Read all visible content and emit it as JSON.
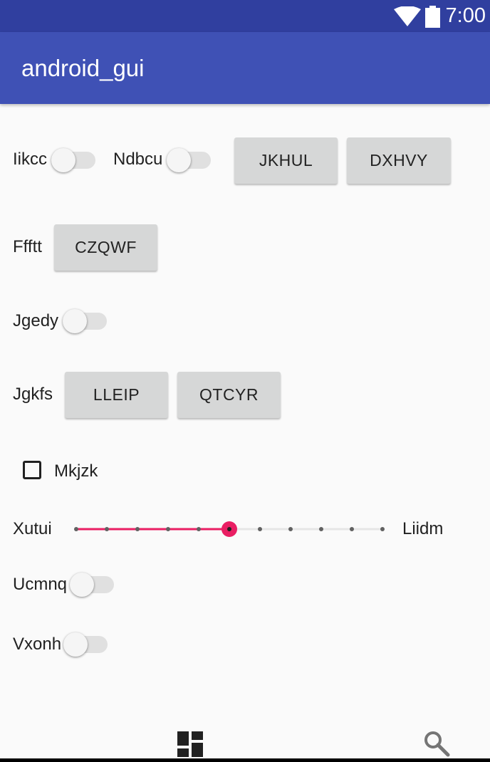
{
  "status_bar": {
    "time": "7:00"
  },
  "app_bar": {
    "title": "android_gui"
  },
  "rows": {
    "switch_likcc": "Iikcc",
    "switch_ndbcu": "Ndbcu",
    "button_jkhul": "JKHUL",
    "button_dxhvy": "DXHVY",
    "label_fffft": "Ffftt",
    "button_czqwf": "CZQWF",
    "switch_jgedy": "Jgedy",
    "label_jgkfs": "Jgkfs",
    "button_lleip": "LLEIP",
    "button_qtcyr": "QTCYR",
    "checkbox_mkjzk": "Mkjzk",
    "seek_left": "Xutui",
    "seek_right": "Liidm",
    "switch_ucmnq": "Ucmnq",
    "switch_vxonh": "Vxonh"
  },
  "seek_bar": {
    "steps": 10,
    "value": 5,
    "active_color": "#e91e63"
  },
  "switches": {
    "likcc": false,
    "ndbcu": false,
    "jgedy": false,
    "ucmnq": false,
    "vxonh": false
  },
  "checkbox": {
    "checked": false
  },
  "bottom_nav": {
    "icons": [
      "dashboard-icon",
      "search-icon"
    ]
  }
}
